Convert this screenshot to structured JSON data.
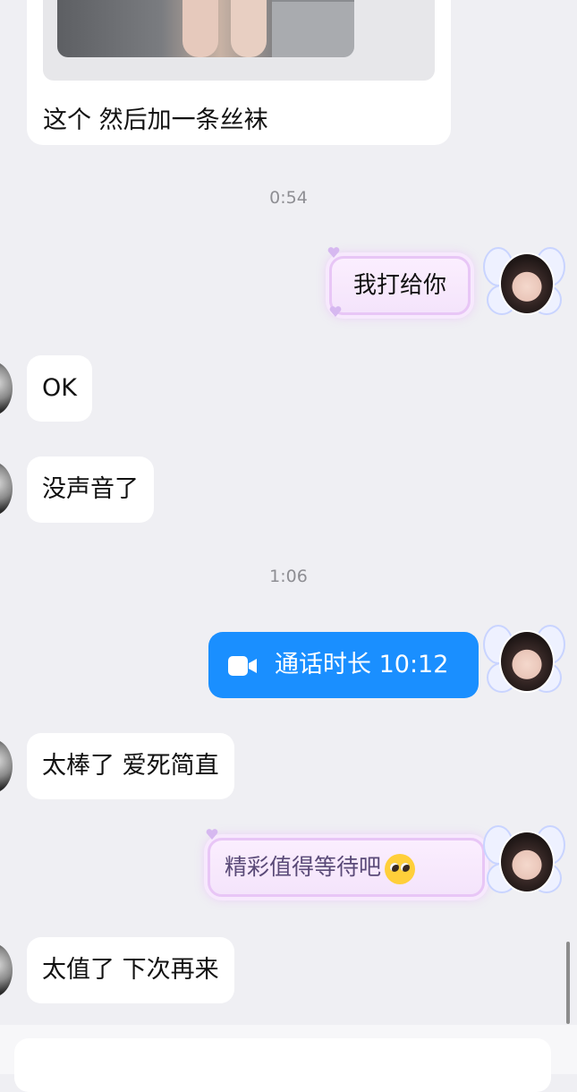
{
  "messages": {
    "photo_caption": "这个 然后加一条丝袜",
    "time_1": "0:54",
    "sent_sticker_1": "我打给你",
    "recv_ok": "OK",
    "recv_no_sound": "没声音了",
    "time_2": "1:06",
    "call_duration": "通话时长 10:12",
    "recv_great": "太棒了 爱死简直",
    "sent_sticker_2": "精彩值得等待吧",
    "recv_worth": "太值了 下次再来"
  },
  "icons": {
    "call": "video-camera-icon",
    "emoji": "pleading-face-icon"
  },
  "colors": {
    "background": "#efeff3",
    "sent_blue": "#1a8fff",
    "bubble_white": "#ffffff",
    "timestamp_gray": "#8e8e93"
  }
}
